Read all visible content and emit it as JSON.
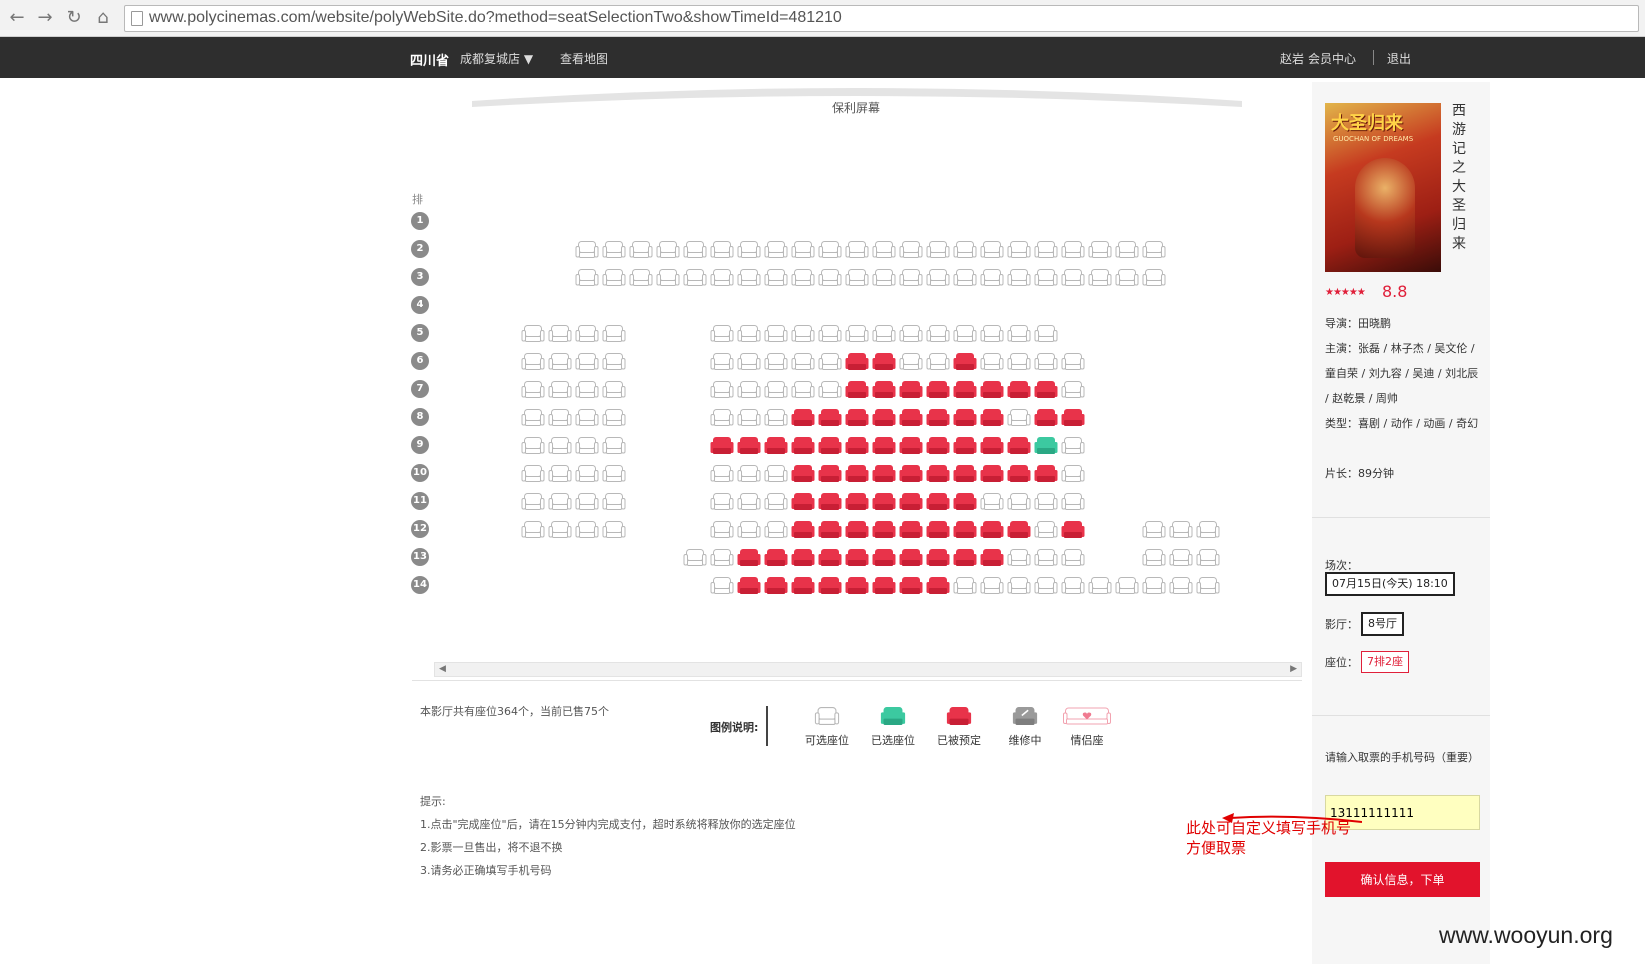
{
  "browser": {
    "url": "www.polycinemas.com/website/polyWebSite.do?method=seatSelectionTwo&showTimeId=481210",
    "back_icon": "arrow-left-icon",
    "forward_icon": "arrow-right-icon",
    "reload_icon": "reload-icon",
    "home_icon": "home-icon"
  },
  "header": {
    "province": "四川省",
    "city": "成都复城店 ▼",
    "map_link": "查看地图",
    "user": "赵岩",
    "member": "会员中心",
    "logout": "退出"
  },
  "screen": {
    "label": "保利屏幕"
  },
  "seatmap": {
    "row_header": "排",
    "rows": [
      "1",
      "2",
      "3",
      "4",
      "5",
      "6",
      "7",
      "8",
      "9",
      "10",
      "11",
      "12",
      "13",
      "14"
    ],
    "summary": "本影厅共有座位364个，当前已售75个"
  },
  "legend": {
    "title": "图例说明:",
    "items": [
      {
        "label": "可选座位",
        "icon": "available-seat-icon"
      },
      {
        "label": "已选座位",
        "icon": "selected-seat-icon"
      },
      {
        "label": "已被预定",
        "icon": "booked-seat-icon"
      },
      {
        "label": "维修中",
        "icon": "maintenance-seat-icon"
      },
      {
        "label": "情侣座",
        "icon": "couple-seat-icon"
      }
    ]
  },
  "tips": {
    "title": "提示:",
    "lines": [
      "1.点击\"完成座位\"后，请在15分钟内完成支付，超时系统将释放你的选定座位",
      "2.影票一旦售出，将不退不换",
      "3.请务必正确填写手机号码"
    ]
  },
  "movie": {
    "title": "西游记之大圣归来",
    "poster_title": "大圣归来",
    "poster_subtitle": "GUOCHAN OF DREAMS",
    "stars": "★★★★★",
    "rating": "8.8",
    "director": "导演：田晓鹏",
    "cast": "主演：张磊 / 林子杰 / 吴文伦 / 童自荣 / 刘九容 / 吴迪 / 刘北辰 / 赵乾景 / 周帅",
    "genre": "类型：喜剧 / 动作 / 动画 / 奇幻",
    "length": "片长：89分钟"
  },
  "order": {
    "session_label": "场次：",
    "session_value": "07月15日(今天) 18:10",
    "hall_label": "影厅：",
    "hall_value": "8号厅",
    "seat_label": "座位：",
    "seat_value": "7排2座",
    "phone_label": "请输入取票的手机号码（重要）",
    "phone_value": "13111111111",
    "confirm": "确认信息，下单"
  },
  "annotation": {
    "line1": "此处可自定义填写手机号",
    "line2": "方便取票"
  },
  "watermark": "www.wooyun.org",
  "colors": {
    "booked": "#e8334a",
    "selected": "#3cc9a0",
    "available_stroke": "#b8b8b8",
    "accent": "#e2132c"
  }
}
